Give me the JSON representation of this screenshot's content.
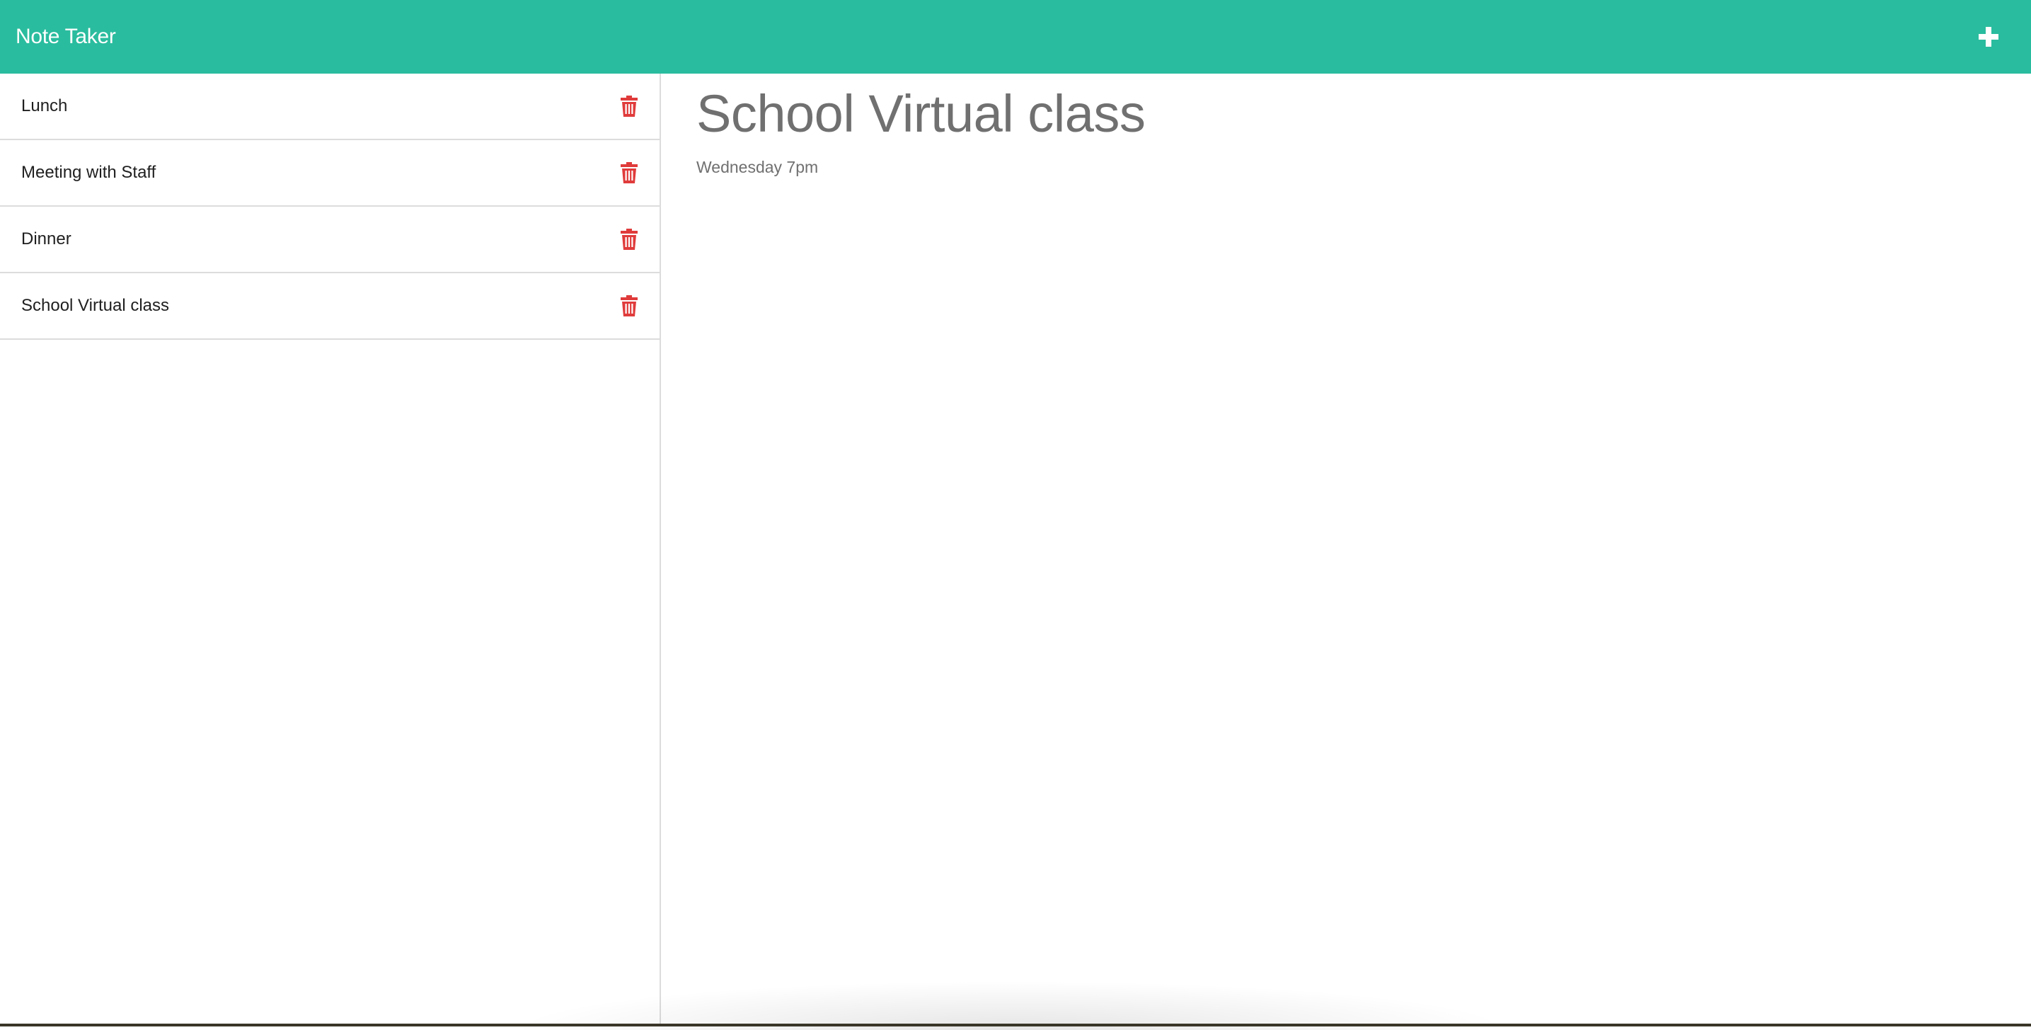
{
  "app": {
    "title": "Note Taker",
    "accent_color": "#2abc9e",
    "danger_color": "#e03b3b"
  },
  "toolbar": {
    "new_note_icon": "plus-icon"
  },
  "sidebar": {
    "notes": [
      {
        "title": "Lunch",
        "delete_icon": "trash-icon"
      },
      {
        "title": "Meeting with Staff",
        "delete_icon": "trash-icon"
      },
      {
        "title": "Dinner",
        "delete_icon": "trash-icon"
      },
      {
        "title": "School Virtual class",
        "delete_icon": "trash-icon"
      }
    ]
  },
  "main": {
    "note_title": "School Virtual class",
    "note_text": "Wednesday 7pm"
  }
}
